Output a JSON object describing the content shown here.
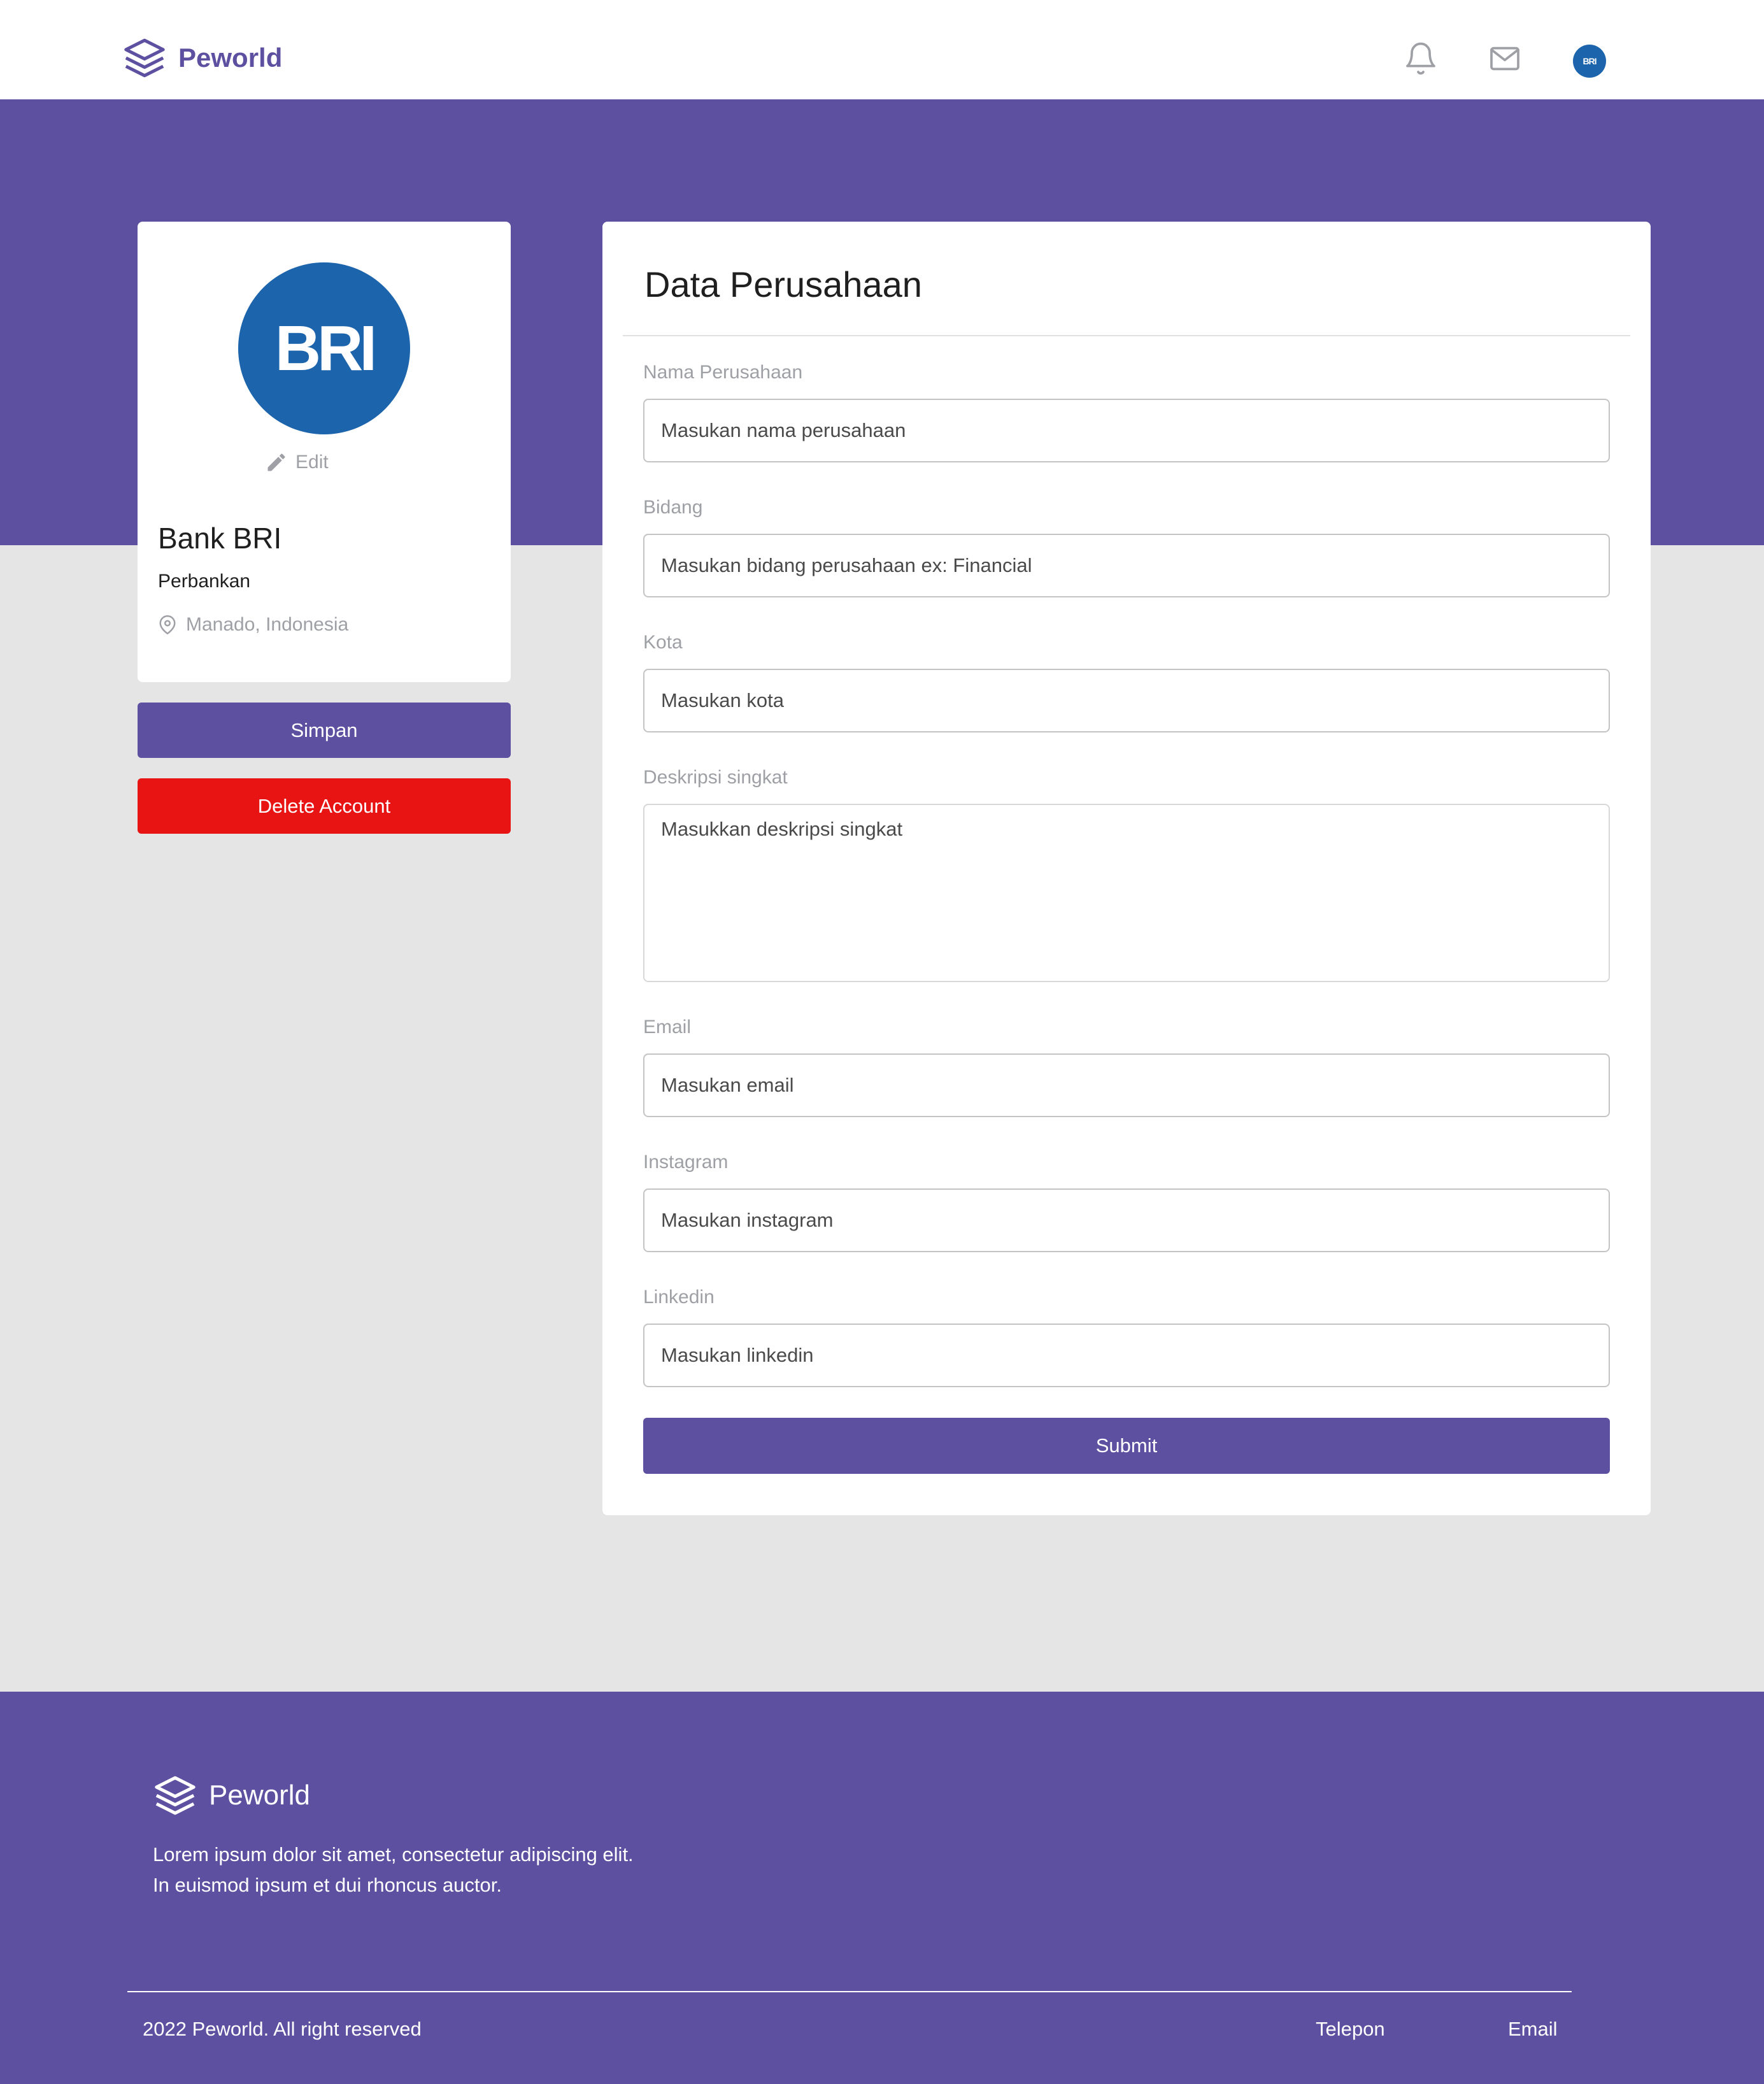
{
  "navbar": {
    "brand": "Peworld",
    "icons": [
      "bell-icon",
      "mail-icon"
    ],
    "avatar_text": "BRI"
  },
  "profile": {
    "logo_text": "BRI",
    "edit_label": "Edit",
    "name": "Bank BRI",
    "field": "Perbankan",
    "location": "Manado, Indonesia",
    "save_label": "Simpan",
    "delete_label": "Delete Account"
  },
  "form": {
    "title": "Data Perusahaan",
    "fields": [
      {
        "label": "Nama Perusahaan",
        "placeholder": "Masukan nama perusahaan"
      },
      {
        "label": "Bidang",
        "placeholder": "Masukan bidang perusahaan ex: Financial"
      },
      {
        "label": "Kota",
        "placeholder": "Masukan kota"
      },
      {
        "label": "Deskripsi singkat",
        "placeholder": "Masukkan deskripsi singkat"
      },
      {
        "label": "Email",
        "placeholder": "Masukan email"
      },
      {
        "label": "Instagram",
        "placeholder": "Masukan instagram"
      },
      {
        "label": "Linkedin",
        "placeholder": "Masukan linkedin"
      }
    ],
    "submit_label": "Submit"
  },
  "footer": {
    "brand": "Peworld",
    "description": "Lorem ipsum dolor sit amet, consectetur adipiscing elit. In euismod ipsum et dui rhoncus auctor.",
    "copyright": "2022 Peworld. All right reserved",
    "links": [
      "Telepon",
      "Email"
    ]
  },
  "colors": {
    "primary": "#5e50a1",
    "danger": "#e81313",
    "page_background": "#e5e5e5",
    "brand_blue": "#1c64ac"
  }
}
